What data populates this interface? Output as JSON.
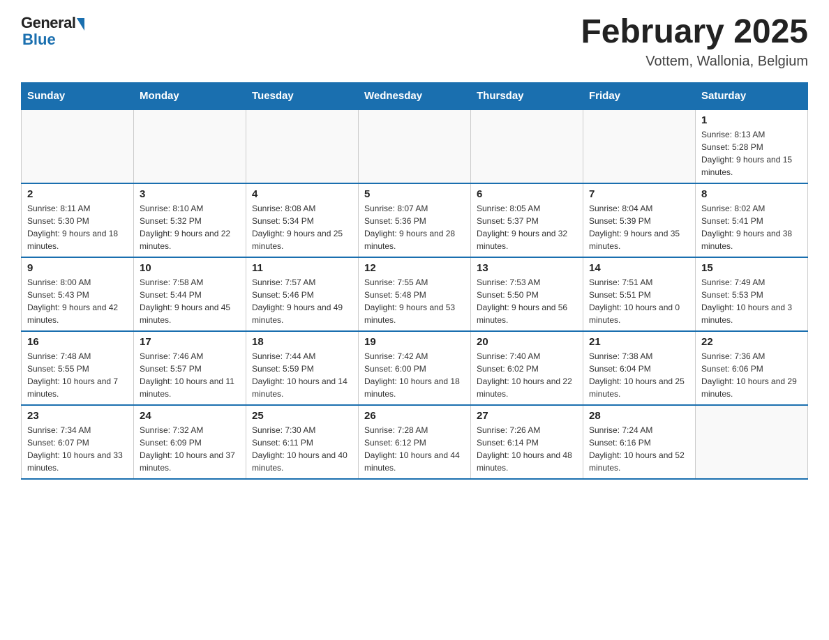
{
  "logo": {
    "general": "General",
    "blue": "Blue"
  },
  "title": "February 2025",
  "location": "Vottem, Wallonia, Belgium",
  "weekdays": [
    "Sunday",
    "Monday",
    "Tuesday",
    "Wednesday",
    "Thursday",
    "Friday",
    "Saturday"
  ],
  "weeks": [
    [
      {
        "day": "",
        "sunrise": "",
        "sunset": "",
        "daylight": ""
      },
      {
        "day": "",
        "sunrise": "",
        "sunset": "",
        "daylight": ""
      },
      {
        "day": "",
        "sunrise": "",
        "sunset": "",
        "daylight": ""
      },
      {
        "day": "",
        "sunrise": "",
        "sunset": "",
        "daylight": ""
      },
      {
        "day": "",
        "sunrise": "",
        "sunset": "",
        "daylight": ""
      },
      {
        "day": "",
        "sunrise": "",
        "sunset": "",
        "daylight": ""
      },
      {
        "day": "1",
        "sunrise": "Sunrise: 8:13 AM",
        "sunset": "Sunset: 5:28 PM",
        "daylight": "Daylight: 9 hours and 15 minutes."
      }
    ],
    [
      {
        "day": "2",
        "sunrise": "Sunrise: 8:11 AM",
        "sunset": "Sunset: 5:30 PM",
        "daylight": "Daylight: 9 hours and 18 minutes."
      },
      {
        "day": "3",
        "sunrise": "Sunrise: 8:10 AM",
        "sunset": "Sunset: 5:32 PM",
        "daylight": "Daylight: 9 hours and 22 minutes."
      },
      {
        "day": "4",
        "sunrise": "Sunrise: 8:08 AM",
        "sunset": "Sunset: 5:34 PM",
        "daylight": "Daylight: 9 hours and 25 minutes."
      },
      {
        "day": "5",
        "sunrise": "Sunrise: 8:07 AM",
        "sunset": "Sunset: 5:36 PM",
        "daylight": "Daylight: 9 hours and 28 minutes."
      },
      {
        "day": "6",
        "sunrise": "Sunrise: 8:05 AM",
        "sunset": "Sunset: 5:37 PM",
        "daylight": "Daylight: 9 hours and 32 minutes."
      },
      {
        "day": "7",
        "sunrise": "Sunrise: 8:04 AM",
        "sunset": "Sunset: 5:39 PM",
        "daylight": "Daylight: 9 hours and 35 minutes."
      },
      {
        "day": "8",
        "sunrise": "Sunrise: 8:02 AM",
        "sunset": "Sunset: 5:41 PM",
        "daylight": "Daylight: 9 hours and 38 minutes."
      }
    ],
    [
      {
        "day": "9",
        "sunrise": "Sunrise: 8:00 AM",
        "sunset": "Sunset: 5:43 PM",
        "daylight": "Daylight: 9 hours and 42 minutes."
      },
      {
        "day": "10",
        "sunrise": "Sunrise: 7:58 AM",
        "sunset": "Sunset: 5:44 PM",
        "daylight": "Daylight: 9 hours and 45 minutes."
      },
      {
        "day": "11",
        "sunrise": "Sunrise: 7:57 AM",
        "sunset": "Sunset: 5:46 PM",
        "daylight": "Daylight: 9 hours and 49 minutes."
      },
      {
        "day": "12",
        "sunrise": "Sunrise: 7:55 AM",
        "sunset": "Sunset: 5:48 PM",
        "daylight": "Daylight: 9 hours and 53 minutes."
      },
      {
        "day": "13",
        "sunrise": "Sunrise: 7:53 AM",
        "sunset": "Sunset: 5:50 PM",
        "daylight": "Daylight: 9 hours and 56 minutes."
      },
      {
        "day": "14",
        "sunrise": "Sunrise: 7:51 AM",
        "sunset": "Sunset: 5:51 PM",
        "daylight": "Daylight: 10 hours and 0 minutes."
      },
      {
        "day": "15",
        "sunrise": "Sunrise: 7:49 AM",
        "sunset": "Sunset: 5:53 PM",
        "daylight": "Daylight: 10 hours and 3 minutes."
      }
    ],
    [
      {
        "day": "16",
        "sunrise": "Sunrise: 7:48 AM",
        "sunset": "Sunset: 5:55 PM",
        "daylight": "Daylight: 10 hours and 7 minutes."
      },
      {
        "day": "17",
        "sunrise": "Sunrise: 7:46 AM",
        "sunset": "Sunset: 5:57 PM",
        "daylight": "Daylight: 10 hours and 11 minutes."
      },
      {
        "day": "18",
        "sunrise": "Sunrise: 7:44 AM",
        "sunset": "Sunset: 5:59 PM",
        "daylight": "Daylight: 10 hours and 14 minutes."
      },
      {
        "day": "19",
        "sunrise": "Sunrise: 7:42 AM",
        "sunset": "Sunset: 6:00 PM",
        "daylight": "Daylight: 10 hours and 18 minutes."
      },
      {
        "day": "20",
        "sunrise": "Sunrise: 7:40 AM",
        "sunset": "Sunset: 6:02 PM",
        "daylight": "Daylight: 10 hours and 22 minutes."
      },
      {
        "day": "21",
        "sunrise": "Sunrise: 7:38 AM",
        "sunset": "Sunset: 6:04 PM",
        "daylight": "Daylight: 10 hours and 25 minutes."
      },
      {
        "day": "22",
        "sunrise": "Sunrise: 7:36 AM",
        "sunset": "Sunset: 6:06 PM",
        "daylight": "Daylight: 10 hours and 29 minutes."
      }
    ],
    [
      {
        "day": "23",
        "sunrise": "Sunrise: 7:34 AM",
        "sunset": "Sunset: 6:07 PM",
        "daylight": "Daylight: 10 hours and 33 minutes."
      },
      {
        "day": "24",
        "sunrise": "Sunrise: 7:32 AM",
        "sunset": "Sunset: 6:09 PM",
        "daylight": "Daylight: 10 hours and 37 minutes."
      },
      {
        "day": "25",
        "sunrise": "Sunrise: 7:30 AM",
        "sunset": "Sunset: 6:11 PM",
        "daylight": "Daylight: 10 hours and 40 minutes."
      },
      {
        "day": "26",
        "sunrise": "Sunrise: 7:28 AM",
        "sunset": "Sunset: 6:12 PM",
        "daylight": "Daylight: 10 hours and 44 minutes."
      },
      {
        "day": "27",
        "sunrise": "Sunrise: 7:26 AM",
        "sunset": "Sunset: 6:14 PM",
        "daylight": "Daylight: 10 hours and 48 minutes."
      },
      {
        "day": "28",
        "sunrise": "Sunrise: 7:24 AM",
        "sunset": "Sunset: 6:16 PM",
        "daylight": "Daylight: 10 hours and 52 minutes."
      },
      {
        "day": "",
        "sunrise": "",
        "sunset": "",
        "daylight": ""
      }
    ]
  ]
}
